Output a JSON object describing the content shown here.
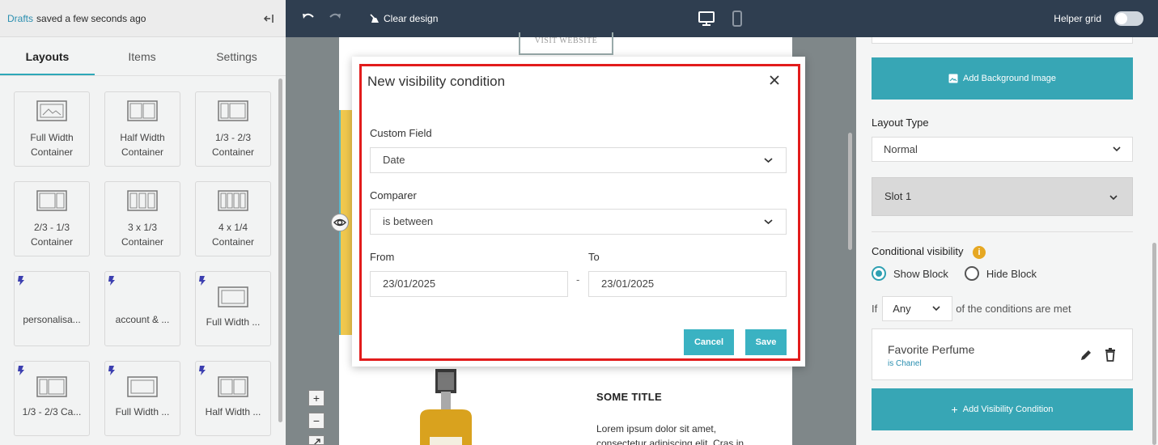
{
  "left_panel": {
    "drafts_link": "Drafts",
    "saved_text": "saved a few seconds ago",
    "tabs": [
      {
        "label": "Layouts",
        "active": true
      },
      {
        "label": "Items",
        "active": false
      },
      {
        "label": "Settings",
        "active": false
      }
    ],
    "layout_tiles": [
      {
        "line1": "Full Width",
        "line2": "Container",
        "icon": "full-width-layout-icon"
      },
      {
        "line1": "Half Width",
        "line2": "Container",
        "icon": "half-width-layout-icon"
      },
      {
        "line1": "1/3 - 2/3",
        "line2": "Container",
        "icon": "one-third-two-thirds-layout-icon"
      },
      {
        "line1": "2/3 - 1/3",
        "line2": "Container",
        "icon": "two-thirds-one-third-layout-icon"
      },
      {
        "line1": "3 x 1/3",
        "line2": "Container",
        "icon": "three-column-layout-icon"
      },
      {
        "line1": "4 x 1/4",
        "line2": "Container",
        "icon": "four-column-layout-icon"
      },
      {
        "label": "personalisa...",
        "icon": "bolt-icon"
      },
      {
        "label": "account & ...",
        "icon": "bolt-icon"
      },
      {
        "label": "Full Width ...",
        "icon": "bolt-icon"
      },
      {
        "label": "1/3 - 2/3 Ca...",
        "icon": "bolt-icon"
      },
      {
        "label": "Full Width ...",
        "icon": "bolt-icon"
      },
      {
        "label": "Half Width ...",
        "icon": "bolt-icon"
      }
    ]
  },
  "topbar": {
    "clear_design": "Clear design",
    "helper_grid": "Helper grid",
    "helper_grid_on": false
  },
  "canvas": {
    "visit_website": "VISIT WEBSITE",
    "some_title": "SOME TITLE",
    "lorem_line1": "Lorem ipsum dolor sit amet,",
    "lorem_line2": "consectetur adipiscing elit. Cras in",
    "zoom_in": "+",
    "zoom_out": "−"
  },
  "right_panel": {
    "add_background_image": "Add Background Image",
    "layout_type_label": "Layout Type",
    "layout_type_value": "Normal",
    "slot_label": "Slot 1",
    "conditional_visibility_label": "Conditional visibility",
    "info_badge": "i",
    "show_block": "Show Block",
    "hide_block": "Hide Block",
    "selected_visibility": "Show Block",
    "if_label": "If",
    "any_value": "Any",
    "conditions_met": "of the conditions are met",
    "condition": {
      "name": "Favorite Perfume",
      "detail": "is Chanel"
    },
    "add_visibility_condition": "Add Visibility Condition"
  },
  "modal": {
    "title": "New visibility condition",
    "custom_field_label": "Custom Field",
    "custom_field_value": "Date",
    "comparer_label": "Comparer",
    "comparer_value": "is between",
    "from_label": "From",
    "to_label": "To",
    "from_value": "23/01/2025",
    "separator": "-",
    "to_value": "23/01/2025",
    "cancel": "Cancel",
    "save": "Save"
  },
  "colors": {
    "accent": "#37a6b5",
    "topbar": "#2f3e50",
    "highlight_outline": "#e21c1c",
    "warning": "#e6a823"
  }
}
